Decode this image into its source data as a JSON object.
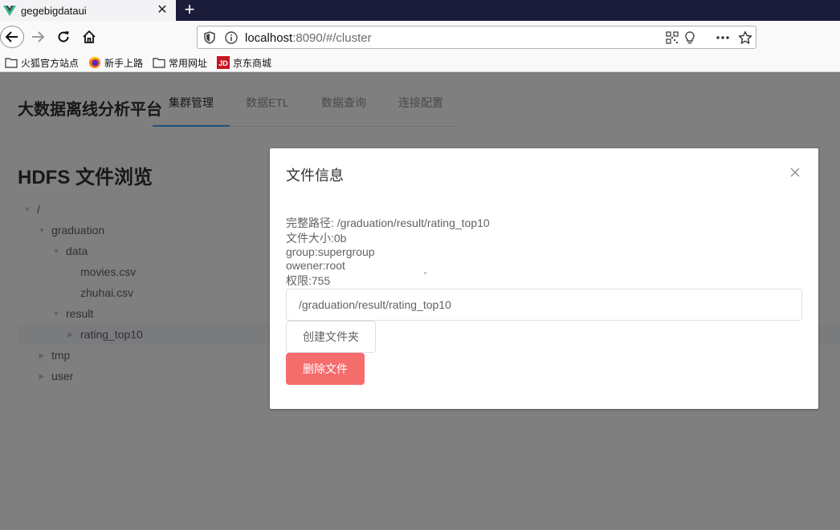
{
  "browser": {
    "tab_title": "gegebigdataui",
    "url_host": "localhost",
    "url_rest": ":8090/#/cluster",
    "bookmarks": [
      "火狐官方站点",
      "新手上路",
      "常用网址",
      "京东商城"
    ]
  },
  "app": {
    "title": "大数据离线分析平台",
    "menu": [
      "集群管理",
      "数据ETL",
      "数据查询",
      "连接配置"
    ],
    "active_menu": 0,
    "heading": "HDFS 文件浏览"
  },
  "tree": [
    {
      "label": "/",
      "level": 0,
      "expanded": true
    },
    {
      "label": "graduation",
      "level": 1,
      "expanded": true
    },
    {
      "label": "data",
      "level": 2,
      "expanded": true
    },
    {
      "label": "movies.csv",
      "level": 3,
      "leaf": true
    },
    {
      "label": "zhuhai.csv",
      "level": 3,
      "leaf": true
    },
    {
      "label": "result",
      "level": 2,
      "expanded": true
    },
    {
      "label": "rating_top10",
      "level": 3,
      "expanded": false,
      "current": true
    },
    {
      "label": "tmp",
      "level": 1,
      "expanded": false
    },
    {
      "label": "user",
      "level": 1,
      "expanded": false
    }
  ],
  "dialog": {
    "title": "文件信息",
    "info": [
      "完整路径: /graduation/result/rating_top10",
      "文件大小:0b",
      "group:supergroup",
      "owener:root",
      "权限:755"
    ],
    "path_value": "/graduation/result/rating_top10",
    "create_folder_label": "创建文件夹",
    "delete_file_label": "删除文件"
  },
  "colors": {
    "accent": "#409eff",
    "danger": "#f56c6c",
    "tab_strip": "#1b1b3a"
  }
}
